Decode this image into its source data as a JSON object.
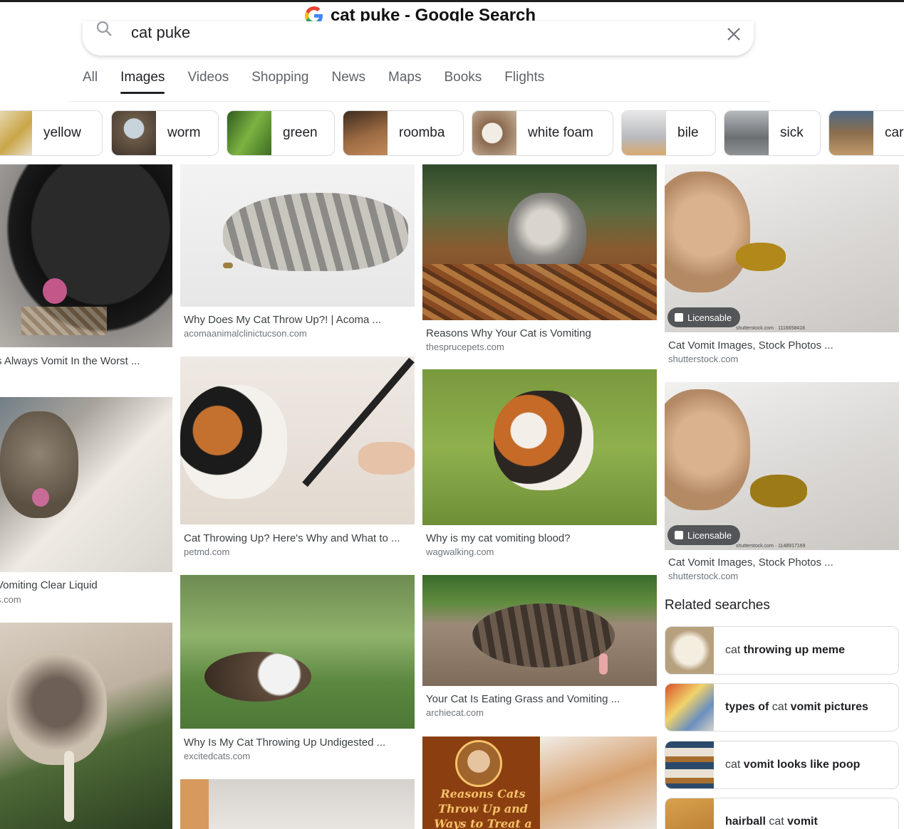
{
  "window": {
    "title": "cat puke - Google Search"
  },
  "search": {
    "query": "cat puke"
  },
  "tabs": [
    {
      "label": "All"
    },
    {
      "label": "Images"
    },
    {
      "label": "Videos"
    },
    {
      "label": "Shopping"
    },
    {
      "label": "News"
    },
    {
      "label": "Maps"
    },
    {
      "label": "Books"
    },
    {
      "label": "Flights"
    }
  ],
  "chips": [
    {
      "label": "yellow",
      "color": "#d8c48a"
    },
    {
      "label": "worm",
      "color": "#8b7d6a"
    },
    {
      "label": "green",
      "color": "#5e8d3c"
    },
    {
      "label": "roomba",
      "color": "#7a5638"
    },
    {
      "label": "white foam",
      "color": "#b89b80"
    },
    {
      "label": "bile",
      "color": "#b8b9bc"
    },
    {
      "label": "sick",
      "color": "#6b6f72"
    },
    {
      "label": "car",
      "color": "#8c6e4d"
    }
  ],
  "results": [
    {
      "title": "s Always Vomit In the Worst ...",
      "source": ""
    },
    {
      "title": "Vomiting Clear Liquid",
      "source": "s.com"
    },
    {
      "title": "Why Does My Cat Throw Up?! | Acoma ...",
      "source": "acomaanimalclinictucson.com"
    },
    {
      "title": "Cat Throwing Up? Here's Why and What to ...",
      "source": "petmd.com"
    },
    {
      "title": "Why Is My Cat Throwing Up Undigested ...",
      "source": "excitedcats.com"
    },
    {
      "title": "Reasons Why Your Cat is Vomiting",
      "source": "thesprucepets.com"
    },
    {
      "title": "Why is my cat vomiting blood?",
      "source": "wagwalking.com"
    },
    {
      "title": "Your Cat Is Eating Grass and Vomiting ...",
      "source": "archiecat.com"
    },
    {
      "title": "Cat Vomit Images, Stock Photos ...",
      "source": "shutterstock.com",
      "badge": "Licensable",
      "watermark": "shutterstock.com · 1116658418"
    },
    {
      "title": "Cat Vomit Images, Stock Photos ...",
      "source": "shutterstock.com",
      "badge": "Licensable",
      "watermark": "shutterstock.com · 1148917169"
    }
  ],
  "promo_image_text": "Reasons Cats Throw Up and Ways to Treat a",
  "related": {
    "title": "Related searches",
    "items": [
      {
        "pre": "cat ",
        "bold": "throwing up meme",
        "post": ""
      },
      {
        "pre": "",
        "bold": "types of",
        "post": " cat ",
        "bold2": "vomit pictures"
      },
      {
        "pre": "cat ",
        "bold": "vomit looks like poop",
        "post": ""
      },
      {
        "pre": "",
        "bold": "hairball",
        "post": " cat ",
        "bold2": "vomit"
      }
    ]
  }
}
